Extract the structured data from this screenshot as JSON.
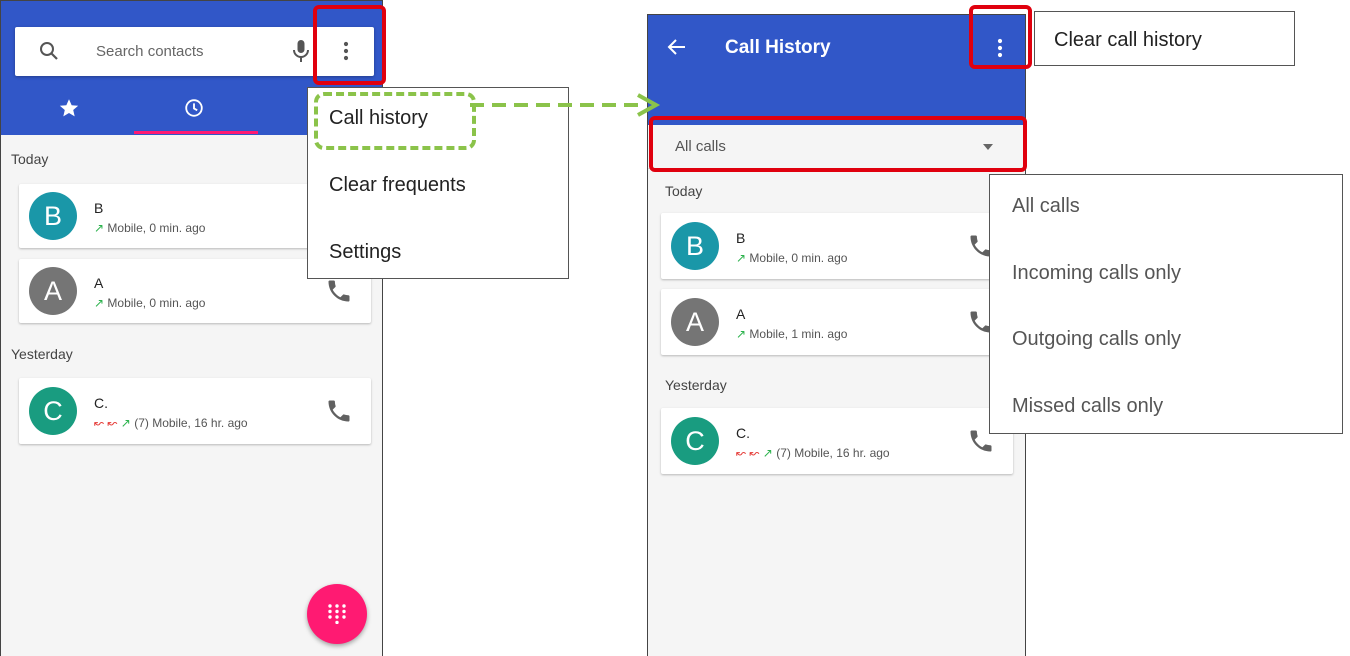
{
  "contacts_screen": {
    "search": {
      "placeholder": "Search contacts"
    },
    "tabs": [
      {
        "name": "Favorites",
        "icon": "star-icon"
      },
      {
        "name": "Recents",
        "icon": "clock-icon"
      }
    ],
    "sections": [
      "Today",
      "Yesterday"
    ],
    "entries": [
      {
        "initial": "B",
        "name": "B",
        "detail": "Mobile, 0 min. ago",
        "arrows": "↗",
        "avatar_color": "#1a97a8"
      },
      {
        "initial": "A",
        "name": "A",
        "detail": "Mobile, 0 min. ago",
        "arrows": "↗",
        "avatar_color": "#757575"
      },
      {
        "initial": "C",
        "name": "C.",
        "missed": "↜ ↜",
        "arrows": "↗",
        "detail": "(7) Mobile, 16 hr. ago",
        "avatar_color": "#199c80"
      }
    ],
    "menu": [
      "Call history",
      "Clear frequents",
      "Settings"
    ],
    "fab_icon": "dialpad-icon"
  },
  "history_screen": {
    "title": "Call History",
    "filter_value": "All calls",
    "overflow_menu": [
      "Clear call history"
    ],
    "sections": [
      "Today",
      "Yesterday"
    ],
    "entries": [
      {
        "initial": "B",
        "name": "B",
        "detail": "Mobile, 0 min. ago",
        "arrows": "↗",
        "avatar_color": "#1a97a8"
      },
      {
        "initial": "A",
        "name": "A",
        "detail": "Mobile, 1 min. ago",
        "arrows": "↗",
        "avatar_color": "#757575"
      },
      {
        "initial": "C",
        "name": "C.",
        "missed": "↜ ↜",
        "arrows": "↗",
        "detail": "(7) Mobile, 16 hr. ago",
        "avatar_color": "#199c80"
      }
    ],
    "filter_options": [
      "All calls",
      "Incoming calls only",
      "Outgoing calls only",
      "Missed calls only"
    ]
  },
  "colors": {
    "header_blue": "#3157c8",
    "accent_pink": "#ff1a72",
    "highlight_red": "#e0000e",
    "highlight_green": "#8bc34a"
  }
}
